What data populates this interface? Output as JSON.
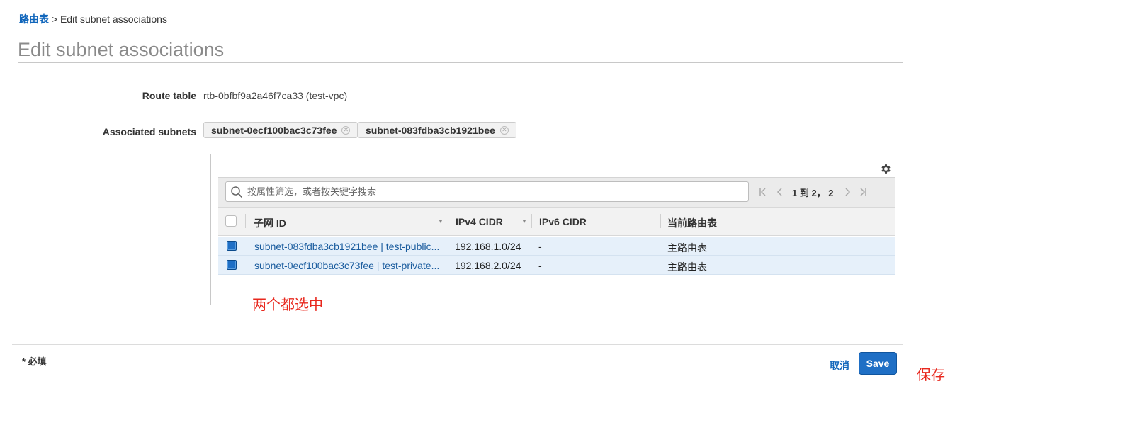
{
  "breadcrumb": {
    "parent": "路由表",
    "separator": ">",
    "current": "Edit subnet associations"
  },
  "page_title": "Edit subnet associations",
  "route_table": {
    "label": "Route table",
    "value": "rtb-0bfbf9a2a46f7ca33 (test-vpc)"
  },
  "associated_subnets": {
    "label": "Associated subnets",
    "tokens": [
      "subnet-0ecf100bac3c73fee",
      "subnet-083fdba3cb1921bee"
    ]
  },
  "table": {
    "search_placeholder": "按属性筛选，或者按关键字搜索",
    "pagination_text": "1 到 2， 2",
    "columns": [
      "子网 ID",
      "IPv4 CIDR",
      "IPv6 CIDR",
      "当前路由表"
    ],
    "rows": [
      {
        "selected": true,
        "subnet": "subnet-083fdba3cb1921bee | test-public...",
        "ipv4": "192.168.1.0/24",
        "ipv6": "-",
        "route_table": "主路由表"
      },
      {
        "selected": true,
        "subnet": "subnet-0ecf100bac3c73fee | test-private...",
        "ipv4": "192.168.2.0/24",
        "ipv6": "-",
        "route_table": "主路由表"
      }
    ]
  },
  "annotations": {
    "select_both": "两个都选中",
    "save_note": "保存"
  },
  "footer": {
    "required": "* 必填",
    "cancel": "取消",
    "save": "Save"
  },
  "colors": {
    "link": "#1166bb",
    "primary_button": "#1f6fc5",
    "selected_row": "#e6f0fa",
    "annotation": "#e8281e"
  },
  "icons": [
    "gear-icon",
    "search-icon",
    "first-page-icon",
    "prev-page-icon",
    "next-page-icon",
    "last-page-icon",
    "remove-token-icon",
    "sort-caret-icon"
  ]
}
